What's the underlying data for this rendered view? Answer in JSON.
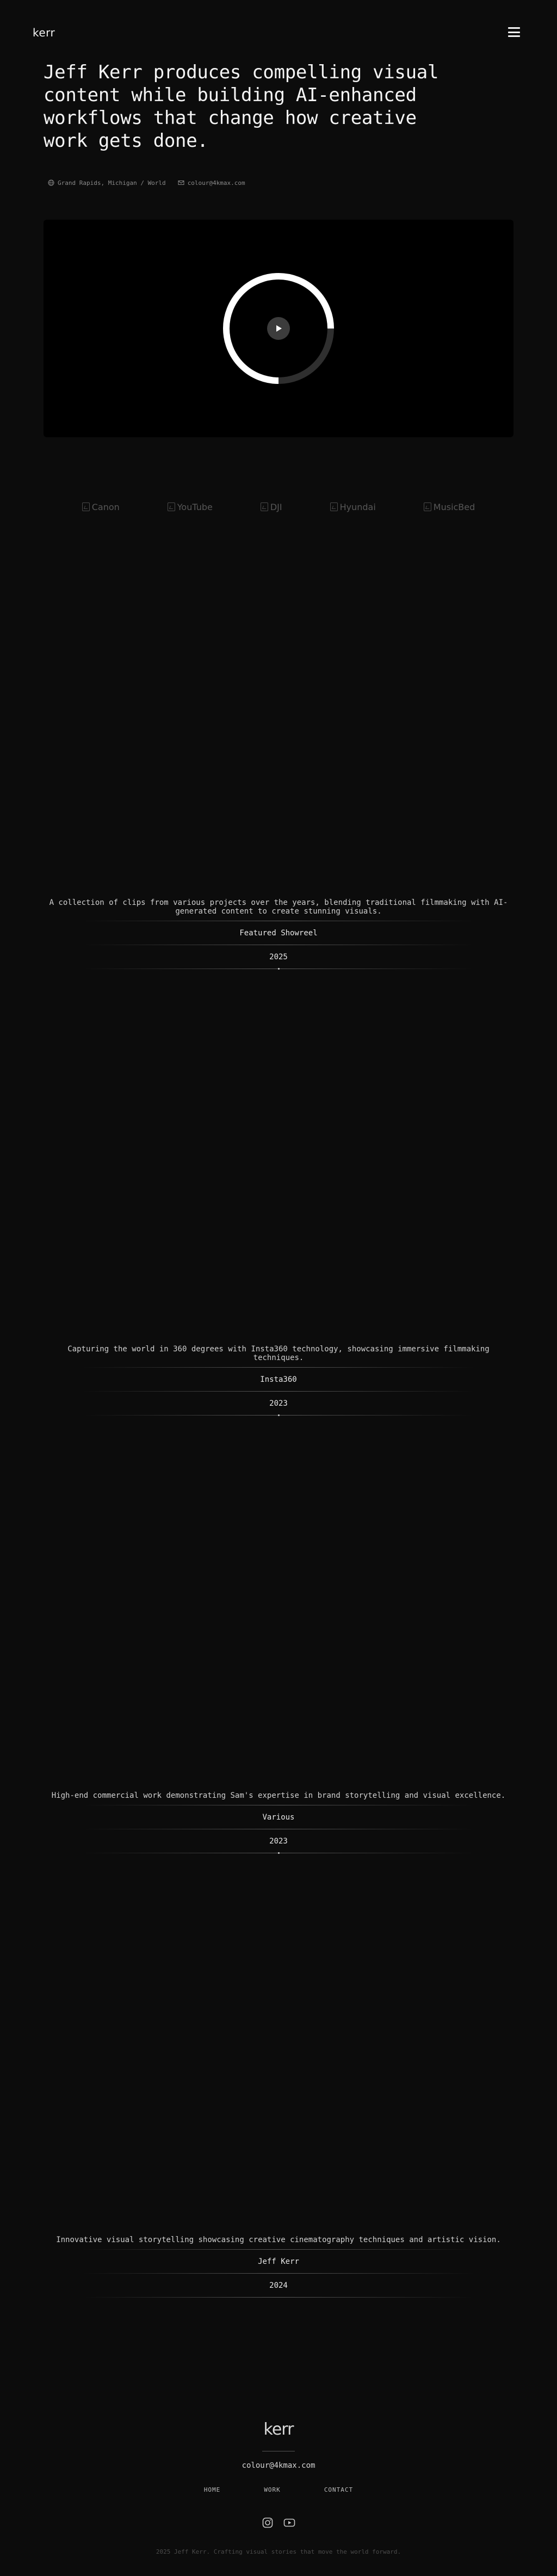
{
  "header": {
    "logo": "kerr",
    "menu_icon": "hamburger-menu-icon"
  },
  "hero": {
    "title": "Jeff Kerr produces compelling visual content while building AI-enhanced workflows that change how creative work gets done.",
    "location": "Grand Rapids, Michigan / World",
    "location_icon": "globe-icon",
    "email": "colour@4kmax.com",
    "email_icon": "mail-icon"
  },
  "video": {
    "play_icon": "play-icon",
    "progress": 0.75
  },
  "clients": [
    {
      "alt": "Canon"
    },
    {
      "alt": "YouTube"
    },
    {
      "alt": "DJI"
    },
    {
      "alt": "Hyundai"
    },
    {
      "alt": "MusicBed"
    }
  ],
  "projects": [
    {
      "description": "A collection of clips from various projects over the years, blending traditional filmmaking with AI-generated content to create stunning visuals.",
      "client": "Featured Showreel",
      "year": "2025"
    },
    {
      "description": "Capturing the world in 360 degrees with Insta360 technology, showcasing immersive filmmaking techniques.",
      "client": "Insta360",
      "year": "2023"
    },
    {
      "description": "High-end commercial work demonstrating Sam's expertise in brand storytelling and visual excellence.",
      "client": "Various",
      "year": "2023"
    },
    {
      "description": "Innovative visual storytelling showcasing creative cinematography techniques and artistic vision.",
      "client": "Jeff Kerr",
      "year": "2024"
    }
  ],
  "footer": {
    "logo": "kerr",
    "email": "colour@4kmax.com",
    "nav": [
      "HOME",
      "WORK",
      "CONTACT"
    ],
    "social": [
      "instagram-icon",
      "youtube-icon"
    ],
    "copyright": "2025 Jeff Kerr. Crafting visual stories that move the world forward."
  }
}
